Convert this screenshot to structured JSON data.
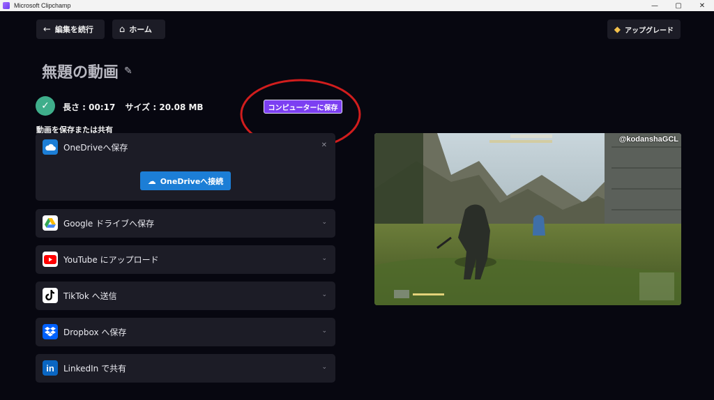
{
  "window": {
    "title": "Microsoft Clipchamp",
    "controls": [
      "—",
      "▢",
      "✕"
    ]
  },
  "nav": {
    "back_label": "編集を続行",
    "home_label": "ホーム",
    "upgrade_label": "アップグレード"
  },
  "video": {
    "title": "無題の動画",
    "length": "長さ : 00:17",
    "size": "サイズ : 20.08 MB",
    "save_to_pc_label": "コンピューターに保存"
  },
  "share": {
    "section_label": "動画を保存または共有",
    "onedrive": {
      "label": "OneDriveへ保存",
      "connect_label": "OneDriveへ接続"
    },
    "items": [
      {
        "label": "Google ドライブへ保存",
        "icon": "google-drive-icon"
      },
      {
        "label": "YouTube にアップロード",
        "icon": "youtube-icon"
      },
      {
        "label": "TikTok へ送信",
        "icon": "tiktok-icon"
      },
      {
        "label": "Dropbox へ保存",
        "icon": "dropbox-icon"
      },
      {
        "label": "LinkedIn で共有",
        "icon": "linkedin-icon"
      }
    ]
  },
  "preview": {
    "watermark": "@kodanshaGCL"
  },
  "colors": {
    "accent": "#7c3ff2",
    "onedrive": "#1c7ed6",
    "success": "#3fae8b",
    "annotation": "#d11d1d"
  }
}
